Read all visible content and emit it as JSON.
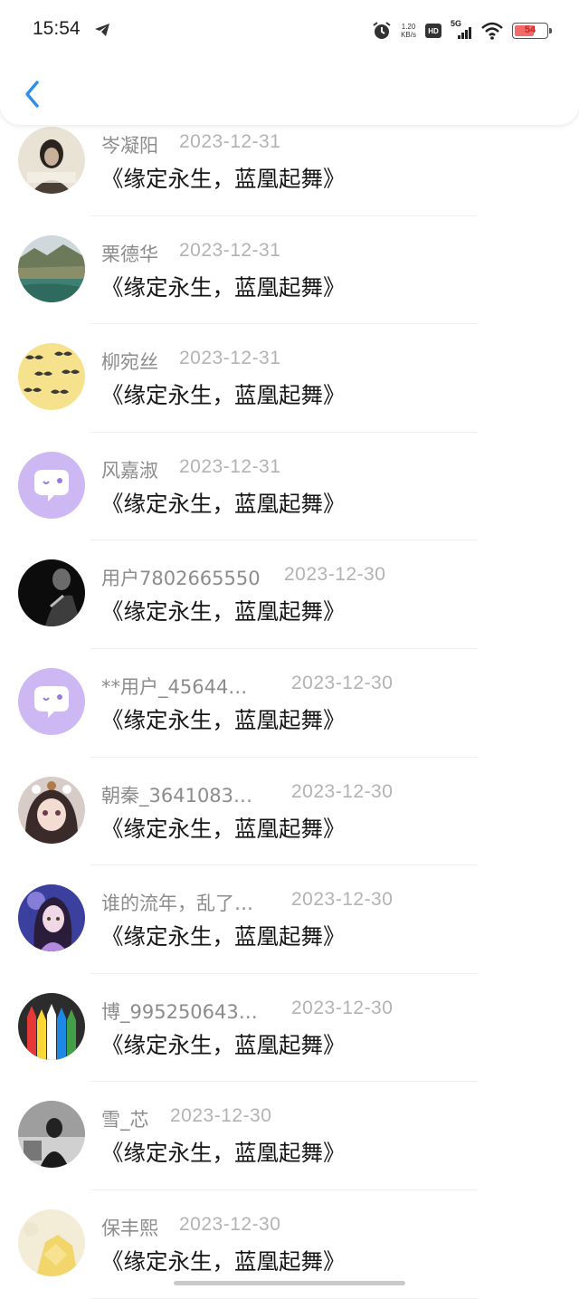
{
  "status_bar": {
    "time": "15:54",
    "net_speed_value": "1.20",
    "net_speed_unit": "KB/s",
    "hd_label": "HD",
    "network_label": "5G",
    "battery_level": "54"
  },
  "colors": {
    "accent": "#2f8fe8",
    "name_text": "#8c8c8c",
    "date_text": "#b3b3b3",
    "title_text": "#161616"
  },
  "items": [
    {
      "name": "岑凝阳",
      "date": "2023-12-31",
      "title": "《缘定永生，蓝凰起舞》",
      "avatar": "photo-girl"
    },
    {
      "name": "栗德华",
      "date": "2023-12-31",
      "title": "《缘定永生，蓝凰起舞》",
      "avatar": "landscape-lake"
    },
    {
      "name": "柳宛丝",
      "date": "2023-12-31",
      "title": "《缘定永生，蓝凰起舞》",
      "avatar": "mustache-pattern"
    },
    {
      "name": "风嘉淑",
      "date": "2023-12-31",
      "title": "《缘定永生，蓝凰起舞》",
      "avatar": "default-chat-bubble"
    },
    {
      "name": "用户7802665550",
      "date": "2023-12-30",
      "title": "《缘定永生，蓝凰起舞》",
      "avatar": "dark-photo"
    },
    {
      "name": "**用户_45644…",
      "date": "2023-12-30",
      "title": "《缘定永生，蓝凰起舞》",
      "avatar": "default-chat-bubble"
    },
    {
      "name": "朝秦_3641083…",
      "date": "2023-12-30",
      "title": "《缘定永生，蓝凰起舞》",
      "avatar": "anime-girl"
    },
    {
      "name": "谁的流年，乱了…",
      "date": "2023-12-30",
      "title": "《缘定永生，蓝凰起舞》",
      "avatar": "anime-purple"
    },
    {
      "name": "博_995250643…",
      "date": "2023-12-30",
      "title": "《缘定永生，蓝凰起舞》",
      "avatar": "color-pencils"
    },
    {
      "name": "雪_芯",
      "date": "2023-12-30",
      "title": "《缘定永生，蓝凰起舞》",
      "avatar": "bw-photo"
    },
    {
      "name": "保丰熙",
      "date": "2023-12-30",
      "title": "《缘定永生，蓝凰起舞》",
      "avatar": "yellow-flower"
    }
  ]
}
